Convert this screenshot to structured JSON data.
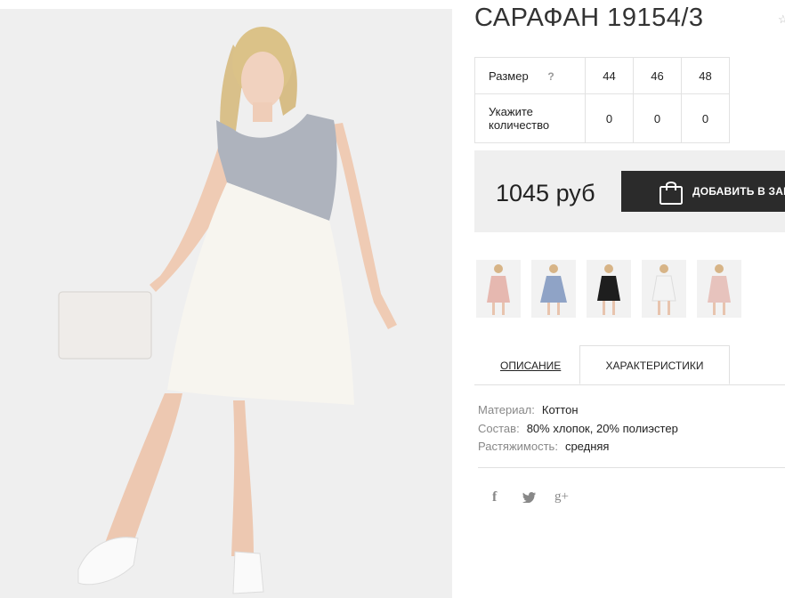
{
  "product": {
    "title": "САРАФАН 19154/3"
  },
  "sizes": {
    "header_label": "Размер",
    "help": "?",
    "size_values": [
      "44",
      "46",
      "48"
    ],
    "qty_label_1": "Укажите",
    "qty_label_2": "количество",
    "qty_values": [
      "0",
      "0",
      "0"
    ]
  },
  "purchase": {
    "price": "1045 руб",
    "add_to_cart": "ДОБАВИТЬ В ЗАКАЗ"
  },
  "thumbnails": [
    {
      "color": "#e6b8b0"
    },
    {
      "color": "#8fa3c6"
    },
    {
      "color": "#1e1e1e"
    },
    {
      "color": "#f3f3f3"
    },
    {
      "color": "#e7c3bd"
    }
  ],
  "tabs": {
    "description": "ОПИСАНИЕ",
    "characteristics": "ХАРАКТЕРИСТИКИ"
  },
  "characteristics": [
    {
      "key": "Материал:",
      "value": "Коттон"
    },
    {
      "key": "Состав:",
      "value": "80% хлопок, 20% полиэстер"
    },
    {
      "key": "Растяжимость:",
      "value": "средняя"
    }
  ],
  "social": {
    "facebook": "f",
    "twitter": "twitter-icon",
    "googleplus": "g+"
  },
  "colors": {
    "accent_dark": "#2b2b2b",
    "panel_bg": "#efefef",
    "dress_top": "#aeb3bd",
    "dress_bottom": "#f7f5ef"
  }
}
